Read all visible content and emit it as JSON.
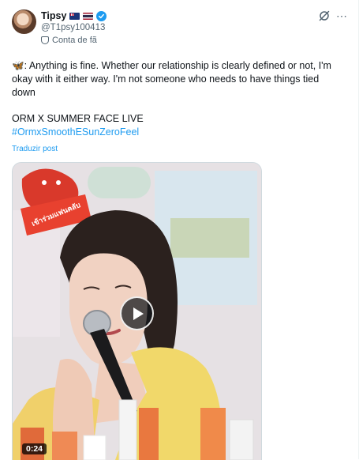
{
  "author": {
    "name": "Tipsy",
    "handle": "@T1psy100413",
    "fan_label": "Conta de fã",
    "flags": [
      "new-zealand-flag-icon",
      "thailand-flag-icon"
    ],
    "verified_color": "#1d9bf0"
  },
  "tweet": {
    "butterfly": "🦋",
    "line1": ": Anything is fine. Whether our relationship is clearly defined or not, I'm okay with it either way. I'm not someone who needs to have things tied down",
    "line2": "ORM X SUMMER FACE LIVE",
    "hashtag": "#OrmxSmoothESunZeroFeel",
    "translate_label": "Traduzir post"
  },
  "media": {
    "type": "video",
    "duration": "0:24",
    "badge_text": "เข้าร่วมแฟนคลับ"
  },
  "colors": {
    "accent": "#1d9bf0",
    "secondary_text": "#536471"
  }
}
